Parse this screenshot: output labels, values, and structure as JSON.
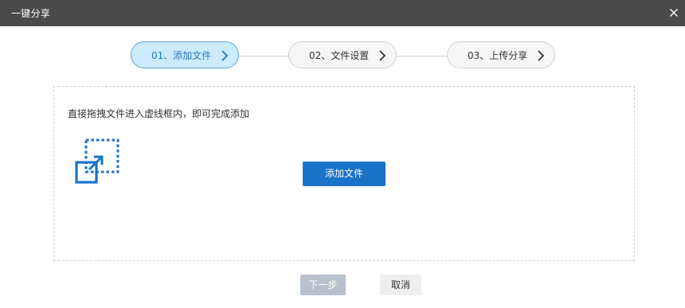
{
  "dialog": {
    "title": "一键分享"
  },
  "steps": [
    {
      "label": "01、添加文件",
      "active": true
    },
    {
      "label": "02、文件设置",
      "active": false
    },
    {
      "label": "03、上传分享",
      "active": false
    }
  ],
  "dropzone": {
    "hint": "直接拖拽文件进入虚线框内，即可完成添加",
    "add_button": "添加文件",
    "icon": "drag-drop-icon"
  },
  "footer": {
    "next_label": "下一步",
    "cancel_label": "取消"
  },
  "colors": {
    "titlebar": "#4a4a4a",
    "active_step_bg": "#ccebff",
    "active_step_border": "#5aa2e0",
    "primary_button": "#1a73c8",
    "disabled_button": "#b7c0cc"
  }
}
